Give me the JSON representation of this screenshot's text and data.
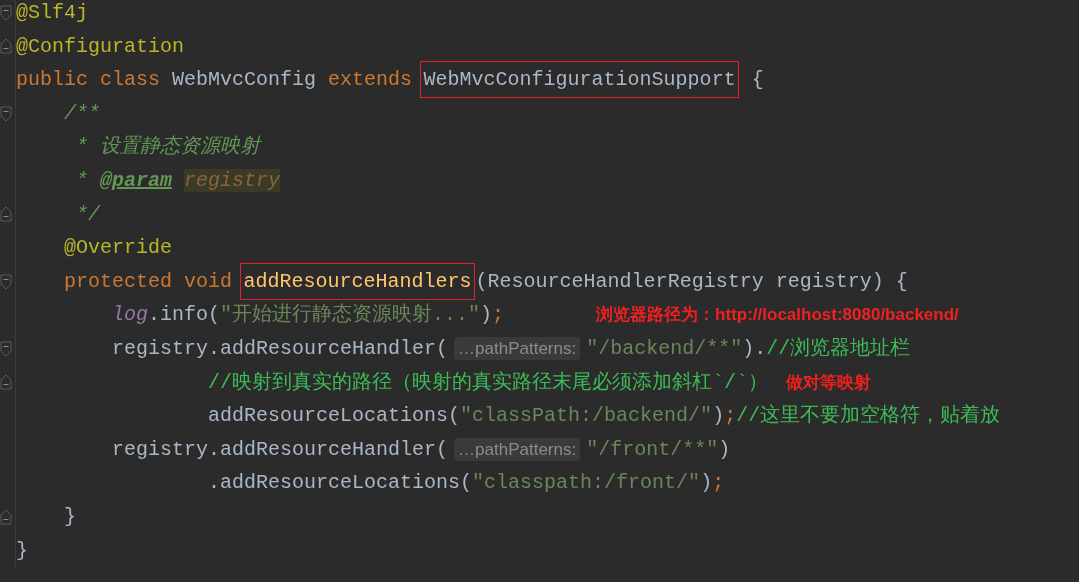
{
  "editor": {
    "lines": [
      {
        "fold_start": true,
        "fold_end": false,
        "tokens": [
          {
            "kind": "annotation",
            "text": "@Slf4j"
          }
        ]
      },
      {
        "fold_start": false,
        "fold_end": true,
        "tokens": [
          {
            "kind": "annotation",
            "text": "@Configuration"
          }
        ]
      },
      {
        "fold_start": false,
        "fold_end": false,
        "tokens": [
          {
            "kind": "keyword",
            "text": "public class "
          },
          {
            "kind": "plain",
            "text": "WebMvcConfig "
          },
          {
            "kind": "keyword",
            "text": "extends "
          },
          {
            "kind": "plain",
            "text": "WebMvcConfigurationSupport",
            "boxed": true
          },
          {
            "kind": "plain",
            "text": " {"
          }
        ]
      },
      {
        "fold_start": true,
        "fold_end": false,
        "tokens": [
          {
            "kind": "doc",
            "text": "    /**"
          }
        ]
      },
      {
        "fold_start": false,
        "fold_end": false,
        "tokens": [
          {
            "kind": "doc",
            "text": "     * 设置静态资源映射"
          }
        ]
      },
      {
        "fold_start": false,
        "fold_end": false,
        "tokens": [
          {
            "kind": "doc",
            "text": "     * "
          },
          {
            "kind": "doctag",
            "text": "@param"
          },
          {
            "kind": "docparam",
            "text": "registry"
          }
        ]
      },
      {
        "fold_start": false,
        "fold_end": true,
        "tokens": [
          {
            "kind": "doc",
            "text": "     */"
          }
        ]
      },
      {
        "fold_start": false,
        "fold_end": false,
        "tokens": [
          {
            "kind": "annotation",
            "text": "    @Override"
          }
        ]
      },
      {
        "fold_start": true,
        "fold_end": false,
        "tokens": [
          {
            "kind": "keyword",
            "text": "    protected void "
          },
          {
            "kind": "method",
            "text": "addResourceHandlers",
            "boxed": true
          },
          {
            "kind": "plain",
            "text": "(ResourceHandlerRegistry registry) {"
          }
        ]
      },
      {
        "fold_start": false,
        "fold_end": false,
        "tokens": [
          {
            "kind": "field",
            "text": "        log"
          },
          {
            "kind": "plain",
            "text": ".info("
          },
          {
            "kind": "string",
            "text": "\"开始进行静态资源映射...\""
          },
          {
            "kind": "plain",
            "text": ")"
          },
          {
            "kind": "keyword",
            "text": ";"
          }
        ],
        "note": "浏览器路径为：http://localhost:8080/backend/"
      },
      {
        "fold_start": true,
        "fold_end": false,
        "tokens": [
          {
            "kind": "plain",
            "text": "        registry.addResourceHandler("
          },
          {
            "kind": "hint",
            "text": "…pathPatterns:"
          },
          {
            "kind": "string",
            "text": "\"/backend/**\""
          },
          {
            "kind": "plain",
            "text": ")."
          },
          {
            "kind": "comment",
            "text": "//浏览器地址栏"
          }
        ]
      },
      {
        "fold_start": false,
        "fold_end": true,
        "tokens": [
          {
            "kind": "comment",
            "text": "                //映射到真实的路径（映射的真实路径末尾必须添加斜杠`/`）"
          }
        ],
        "note": "做对等映射"
      },
      {
        "fold_start": false,
        "fold_end": false,
        "tokens": [
          {
            "kind": "plain",
            "text": "                addResourceLocations("
          },
          {
            "kind": "string",
            "text": "\"classPath:/backend/\""
          },
          {
            "kind": "plain",
            "text": ")"
          },
          {
            "kind": "keyword",
            "text": ";"
          },
          {
            "kind": "comment",
            "text": "//这里不要加空格符，贴着放"
          }
        ]
      },
      {
        "fold_start": false,
        "fold_end": false,
        "tokens": [
          {
            "kind": "plain",
            "text": "        registry.addResourceHandler("
          },
          {
            "kind": "hint",
            "text": "…pathPatterns:"
          },
          {
            "kind": "string",
            "text": "\"/front/**\""
          },
          {
            "kind": "plain",
            "text": ")"
          }
        ]
      },
      {
        "fold_start": false,
        "fold_end": false,
        "tokens": [
          {
            "kind": "plain",
            "text": "                .addResourceLocations("
          },
          {
            "kind": "string",
            "text": "\"classpath:/front/\""
          },
          {
            "kind": "plain",
            "text": ")"
          },
          {
            "kind": "keyword",
            "text": ";"
          }
        ]
      },
      {
        "fold_start": false,
        "fold_end": true,
        "tokens": [
          {
            "kind": "plain",
            "text": "    }"
          }
        ]
      },
      {
        "fold_start": false,
        "fold_end": false,
        "tokens": [
          {
            "kind": "plain",
            "text": "}"
          }
        ]
      }
    ]
  }
}
